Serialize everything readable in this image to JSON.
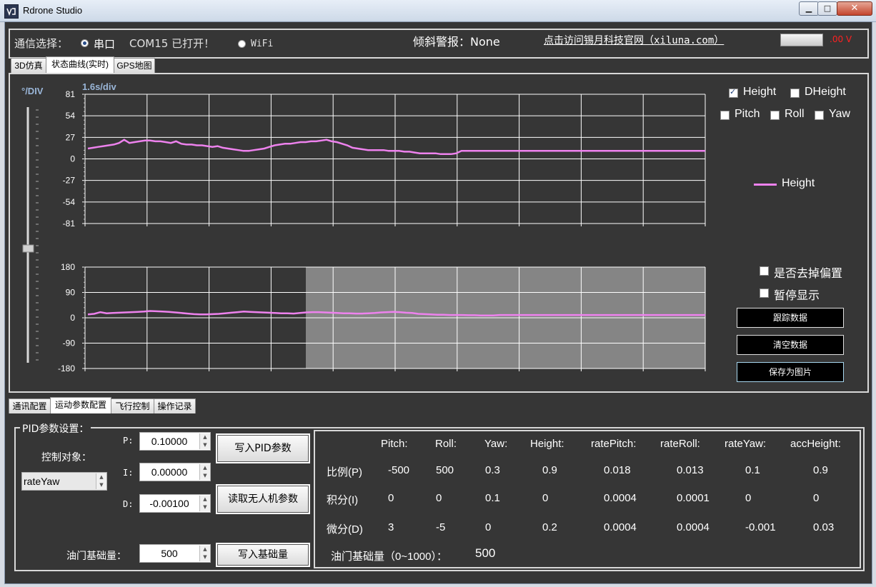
{
  "window": {
    "title": "Rdrone Studio"
  },
  "comm": {
    "label": "通信选择：",
    "serial_label": "串口",
    "serial_selected": true,
    "status": "COM15 已打开！",
    "wifi_label": "WiFi",
    "tilt_alarm": "倾斜警报：None",
    "website": "点击访问锡月科技官网（xiluna.com）",
    "voltage": ".00 V"
  },
  "top_tabs": [
    "3D仿真",
    "状态曲线(实时)",
    "GPS地图"
  ],
  "chart_panel": {
    "scale_label": "°/DIV",
    "time_div": "1.6s/div",
    "checkboxes": [
      {
        "label": "Height",
        "checked": true
      },
      {
        "label": "DHeight",
        "checked": false
      },
      {
        "label": "Pitch",
        "checked": false
      },
      {
        "label": "Roll",
        "checked": false
      },
      {
        "label": "Yaw",
        "checked": false
      }
    ],
    "legend": "Height",
    "remove_offset": "是否去掉偏置",
    "pause_display": "暂停显示",
    "track_button": "跟踪数据",
    "clear_button": "清空数据",
    "save_button": "保存为图片"
  },
  "chart_data": [
    {
      "type": "line",
      "y_ticks": [
        "81",
        "54",
        "27",
        "0",
        "-27",
        "-54",
        "-81"
      ],
      "ylim": [
        -81,
        81
      ],
      "series": [
        {
          "name": "Height",
          "color": "#ee82ee",
          "values": [
            13,
            14,
            15,
            16,
            17,
            18,
            20,
            24,
            20,
            21,
            22,
            23,
            23,
            22,
            22,
            21,
            20,
            22,
            19,
            18,
            18,
            17,
            17,
            16,
            15,
            16,
            14,
            13,
            12,
            11,
            10,
            10,
            11,
            12,
            13,
            15,
            17,
            18,
            19,
            19,
            20,
            21,
            21,
            22,
            22,
            23,
            24,
            22,
            21,
            19,
            17,
            14,
            13,
            12,
            11,
            11,
            11,
            11,
            10,
            10,
            10,
            9,
            9,
            8,
            7,
            7,
            7,
            7,
            6,
            6,
            6,
            7,
            10,
            10,
            10,
            10,
            10,
            10,
            10,
            10,
            10,
            10,
            10,
            10,
            10,
            10,
            10,
            10,
            10,
            10,
            10,
            10,
            10,
            10,
            10,
            10,
            10,
            10,
            10,
            10,
            10,
            10,
            10,
            10,
            10,
            10,
            10,
            10,
            10,
            10,
            10,
            10,
            10,
            10,
            10,
            10,
            10,
            10,
            10,
            10
          ]
        }
      ]
    },
    {
      "type": "line",
      "y_ticks": [
        "180",
        "90",
        "0",
        "-90",
        "-180"
      ],
      "ylim": [
        -180,
        180
      ],
      "series": [
        {
          "name": "Height",
          "color": "#ee82ee",
          "values": [
            12,
            14,
            20,
            16,
            17,
            18,
            19,
            20,
            21,
            22,
            24,
            23,
            22,
            21,
            19,
            17,
            15,
            13,
            12,
            12,
            13,
            14,
            16,
            18,
            20,
            22,
            21,
            20,
            19,
            18,
            17,
            16,
            16,
            15,
            17,
            19,
            20,
            20,
            19,
            18,
            17,
            16,
            16,
            15,
            15,
            16,
            17,
            19,
            20,
            21,
            20,
            18,
            17,
            14,
            13,
            12,
            11,
            11,
            10,
            10,
            10,
            9,
            9,
            8,
            8,
            8,
            10,
            10,
            10,
            10,
            10,
            10,
            10,
            10,
            10,
            10,
            10,
            10,
            10,
            10,
            10,
            10,
            10,
            10,
            10,
            10,
            10,
            10,
            10,
            10,
            10,
            10,
            10,
            10,
            10,
            10,
            10,
            10,
            10,
            10
          ]
        }
      ]
    }
  ],
  "bottom_tabs": [
    "通讯配置",
    "运动参数配置",
    "飞行控制",
    "操作记录"
  ],
  "pid": {
    "legend": "PID参数设置：",
    "control_target_label": "控制对象：",
    "control_target_value": "rateYaw",
    "p_label": "P:",
    "p_value": "0.10000",
    "i_label": "I:",
    "i_value": "0.00000",
    "d_label": "D:",
    "d_value": "-0.00100",
    "write_pid_button": "写入PID参数",
    "read_params_button": "读取无人机参数",
    "throttle_label": "油门基础量：",
    "throttle_value": "500",
    "write_throttle_button": "写入基础量"
  },
  "pid_table": {
    "headers": [
      "Pitch:",
      "Roll:",
      "Yaw:",
      "Height:",
      "ratePitch:",
      "rateRoll:",
      "rateYaw:",
      "accHeight:"
    ],
    "rows": [
      {
        "label": "比例(P)",
        "values": [
          "-500",
          "500",
          "0.3",
          "0.9",
          "0.018",
          "0.013",
          "0.1",
          "0.9"
        ]
      },
      {
        "label": "积分(I)",
        "values": [
          "0",
          "0",
          "0.1",
          "0",
          "0.0004",
          "0.0001",
          "0",
          "0"
        ]
      },
      {
        "label": "微分(D)",
        "values": [
          "3",
          "-5",
          "0",
          "0.2",
          "0.0004",
          "0.0004",
          "-0.001",
          "0.03"
        ]
      }
    ],
    "throttle_range_label": "油门基础量（0~1000）：",
    "throttle_current": "500"
  }
}
